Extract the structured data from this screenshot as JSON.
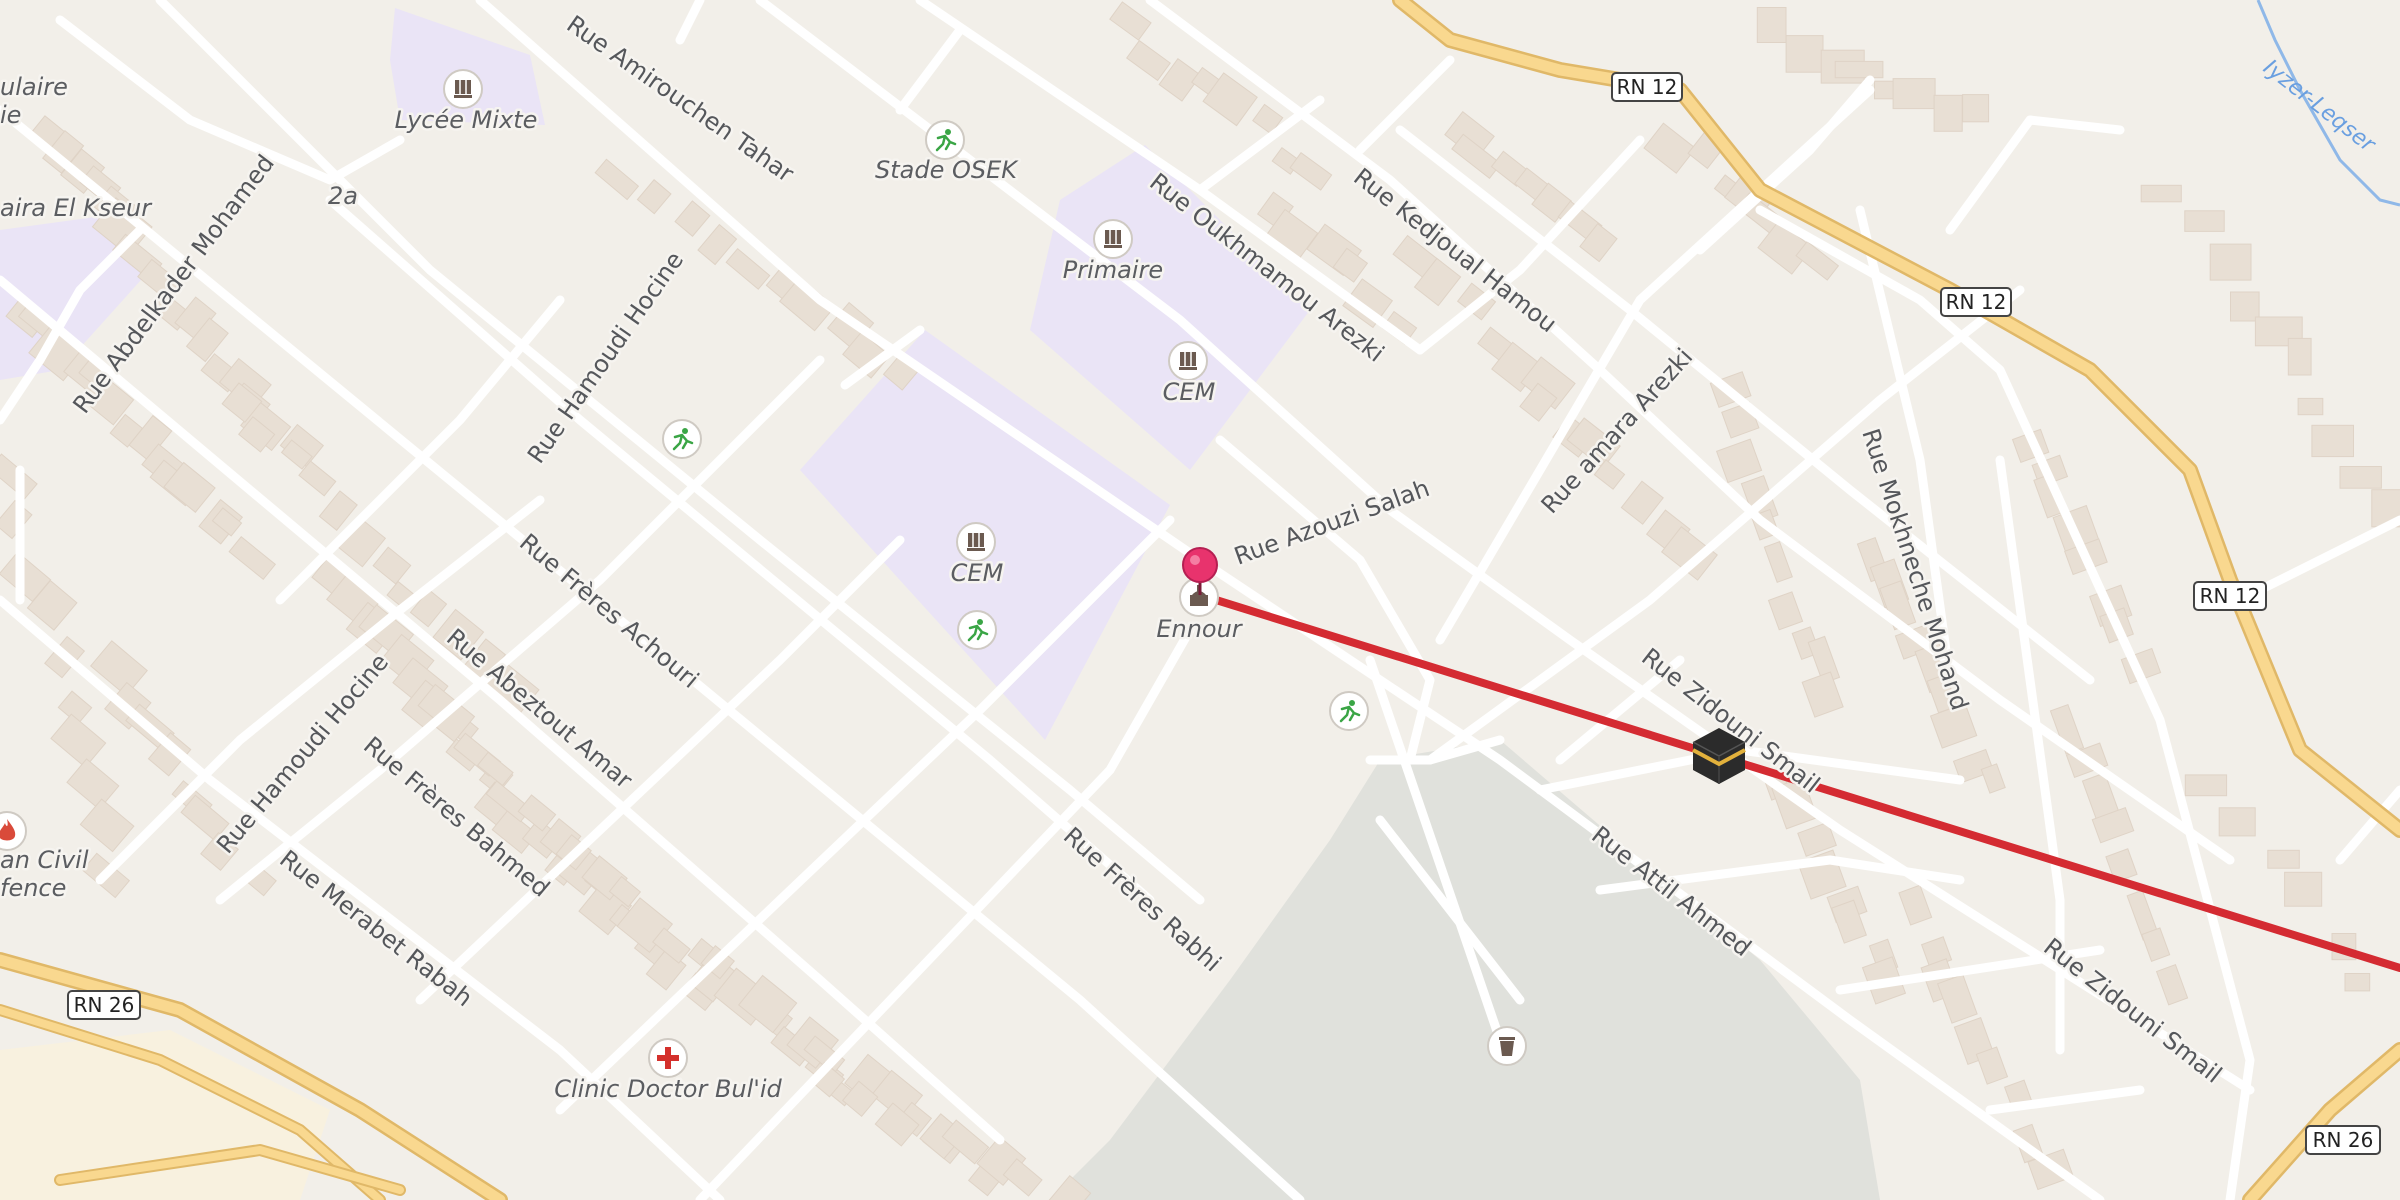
{
  "colors": {
    "background": "#f2efe9",
    "building": "#e7ddd2",
    "school_area": "#eae4f6",
    "park": "#e0e1dc",
    "road_minor": "#ffffff",
    "road_primary": "#f7d38b",
    "route_line": "#d42b32",
    "marker": "#e8336d",
    "river": "#8fb8e8"
  },
  "roads": {
    "national": [
      "RN 12",
      "RN 12",
      "RN 12",
      "RN 26",
      "RN 26"
    ]
  },
  "streets": [
    "Rue Amirouchen Tahar",
    "Rue Abdelkader Mohamed",
    "Rue Hamoudi Hocine",
    "Rue Frères Achouri",
    "Rue Abeztout Amar",
    "Rue Frères Bahmed",
    "Rue Hamoudi Hocine",
    "Rue Merabet Rabah",
    "Rue Frères Rabhi",
    "Rue Oukhmamou Arezki",
    "Rue Kedjoual Hamou",
    "Rue Azouzi Salah",
    "Rue amara Arezki",
    "Rue Mokhneche Mohand",
    "Rue Zidouni Smail",
    "Rue Attil Ahmed",
    "Rue Zidouni Smail"
  ],
  "places": {
    "lycee": "Lycée Mixte",
    "stade": "Stade OSEK",
    "primaire": "Primaire",
    "cem1": "CEM",
    "cem2": "CEM",
    "ennour": "Ennour",
    "clinic": "Clinic Doctor Bul'id",
    "house_number": "2a",
    "edge_top_left_1": "ulaire",
    "edge_top_left_2": "ie",
    "edge_left_school": "aira El Kseur",
    "edge_civil_1": "an Civil",
    "edge_civil_2": "fence"
  },
  "river": "Iyzer-Leqser",
  "icons": [
    "school-icon",
    "sports-icon",
    "mosque-icon",
    "fire-station-icon",
    "clinic-icon",
    "waste-basket-icon",
    "kaaba-icon",
    "location-pin-icon"
  ]
}
